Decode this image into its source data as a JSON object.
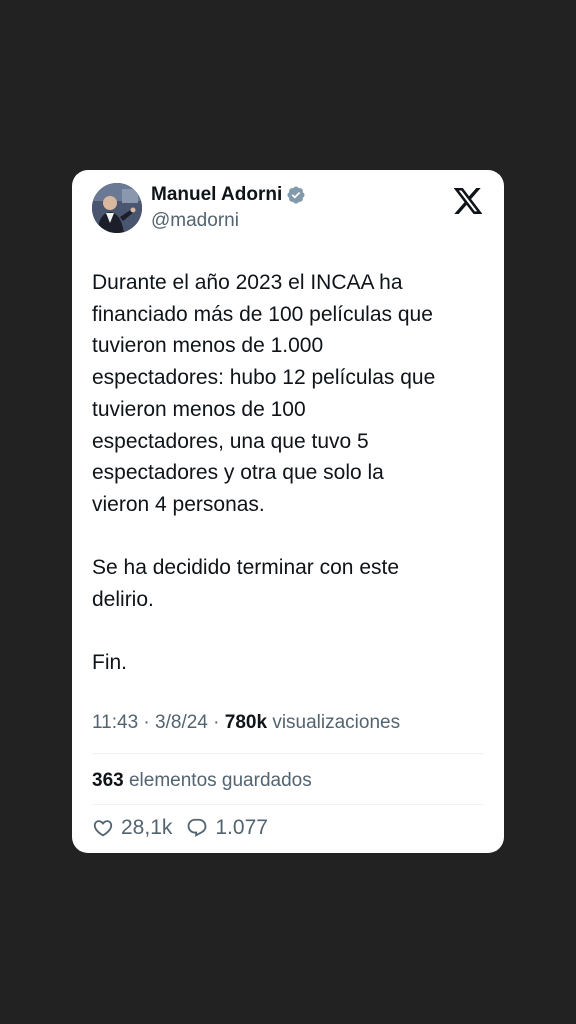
{
  "author": {
    "name": "Manuel Adorni",
    "handle": "@madorni",
    "verified": true,
    "avatar_icon": "profile-photo"
  },
  "brand_icon": "x-logo",
  "tweet": {
    "paragraphs": [
      [
        "Durante el año 2023 el INCAA ha",
        "financiado más de 100 películas que",
        "tuvieron menos de 1.000",
        "espectadores: hubo 12 películas que",
        "tuvieron menos de 100",
        "espectadores, una que tuvo 5",
        "espectadores y otra que solo la",
        "vieron 4 personas."
      ],
      [
        "Se ha decidido terminar con este",
        "delirio."
      ],
      [
        "Fin."
      ]
    ]
  },
  "meta": {
    "time": "11:43",
    "separator": "·",
    "date": "3/8/24",
    "views": "780k",
    "views_label": "visualizaciones"
  },
  "bookmarks": {
    "count": "363",
    "label": "elementos guardados"
  },
  "actions": {
    "likes": "28,1k",
    "replies": "1.077"
  },
  "colors": {
    "background": "#222222",
    "card": "#ffffff",
    "text": "#0f1419",
    "secondary": "#536471",
    "verified": "#829aab"
  }
}
